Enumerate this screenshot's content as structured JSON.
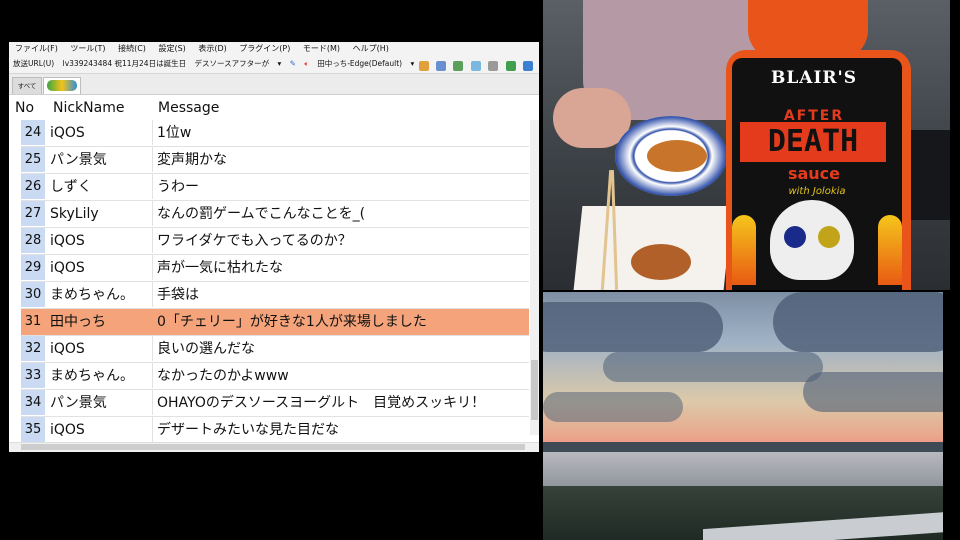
{
  "window": {
    "menu": [
      "ファイル(F)",
      "ツール(T)",
      "接続(C)",
      "設定(S)",
      "表示(D)",
      "プラグイン(P)",
      "モード(M)",
      "ヘルプ(H)"
    ],
    "toolbar": {
      "url_label": "放送URL(U)",
      "broadcast_info": "lv339243484 祝11月24日は誕生日",
      "title_dropdown": "デスソースアフターが",
      "voice_label": "田中っち-Edge(Default)"
    },
    "tabs": {
      "all": "すべて",
      "live": ""
    },
    "columns": {
      "no": "No",
      "nick": "NickName",
      "message": "Message"
    },
    "rows": [
      {
        "no": "24",
        "nick": "iQOS",
        "message": "1位w",
        "highlight": false
      },
      {
        "no": "25",
        "nick": "パン景気",
        "message": "変声期かな",
        "highlight": false
      },
      {
        "no": "26",
        "nick": "しずく",
        "message": "うわー",
        "highlight": false
      },
      {
        "no": "27",
        "nick": "SkyLily",
        "message": "なんの罰ゲームでこんなことを_(",
        "highlight": false
      },
      {
        "no": "28",
        "nick": "iQOS",
        "message": "ワライダケでも入ってるのか？",
        "highlight": false
      },
      {
        "no": "29",
        "nick": "iQOS",
        "message": "声が一気に枯れたな",
        "highlight": false
      },
      {
        "no": "30",
        "nick": "まめちゃん。",
        "message": "手袋は",
        "highlight": false
      },
      {
        "no": "31",
        "nick": "田中っち",
        "message": "0「チェリー」が好きな1人が来場しました",
        "highlight": true
      },
      {
        "no": "32",
        "nick": "iQOS",
        "message": "良いの選んだな",
        "highlight": false
      },
      {
        "no": "33",
        "nick": "まめちゃん。",
        "message": "なかったのかよwww",
        "highlight": false
      },
      {
        "no": "34",
        "nick": "パン景気",
        "message": "OHAYOのデスソースヨーグルト　目覚めスッキリ！",
        "highlight": false
      },
      {
        "no": "35",
        "nick": "iQOS",
        "message": "デザートみたいな見た目だな",
        "highlight": false
      }
    ],
    "highlight_color": "#f4a37a",
    "number_cell_color": "#c9daf2"
  },
  "camera": {
    "bottle_brand": "BLAIR'S",
    "bottle_after": "AFTER",
    "bottle_death": "DEATH",
    "bottle_sauce": "sauce",
    "bottle_with": "with Jolokia"
  }
}
